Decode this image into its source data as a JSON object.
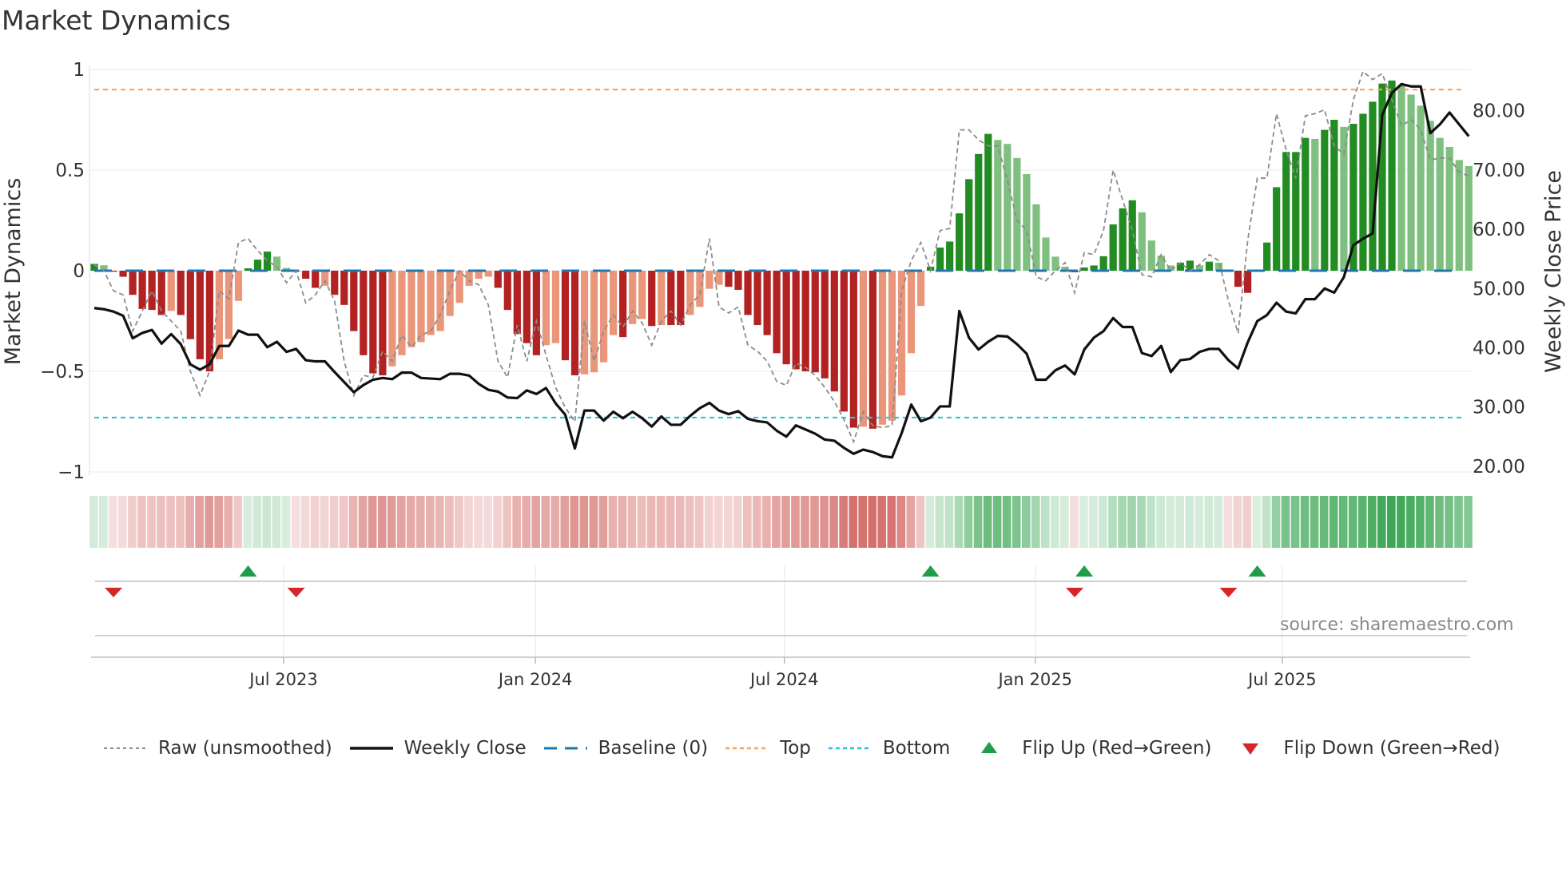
{
  "chart_data": {
    "type": "bar",
    "title": "Market Dynamics",
    "ylabel": "Market Dynamics",
    "y2label": "Weekly Close Price",
    "ylim": [
      -1.05,
      1.0
    ],
    "y2lim": [
      18.8,
      86.5
    ],
    "yticks": [
      {
        "v": 1,
        "label": "1"
      },
      {
        "v": 0.5,
        "label": "0.5"
      },
      {
        "v": 0,
        "label": "0"
      },
      {
        "v": -0.5,
        "label": "−0.5"
      },
      {
        "v": -1,
        "label": "−1"
      }
    ],
    "y2ticks": [
      {
        "v": 80,
        "label": "80.00"
      },
      {
        "v": 70,
        "label": "70.00"
      },
      {
        "v": 60,
        "label": "60.00"
      },
      {
        "v": 50,
        "label": "50.00"
      },
      {
        "v": 40,
        "label": "40.00"
      },
      {
        "v": 30,
        "label": "30.00"
      },
      {
        "v": 20,
        "label": "20.00"
      }
    ],
    "xticks": [
      {
        "week": 19.7,
        "label": "Jul 2023"
      },
      {
        "week": 45.9,
        "label": "Jan 2024"
      },
      {
        "week": 71.8,
        "label": "Jul 2024"
      },
      {
        "week": 97.9,
        "label": "Jan 2025"
      },
      {
        "week": 123.6,
        "label": "Jul 2025"
      }
    ],
    "top_level": 0.9,
    "bottom_level": -0.73,
    "baseline": 0,
    "values": [
      0.034,
      0.027,
      -0.005,
      -0.03,
      -0.12,
      -0.19,
      -0.195,
      -0.22,
      -0.2,
      -0.22,
      -0.34,
      -0.44,
      -0.5,
      -0.44,
      -0.34,
      -0.15,
      0.012,
      0.055,
      0.095,
      0.07,
      0.014,
      -0.003,
      -0.04,
      -0.085,
      -0.075,
      -0.12,
      -0.17,
      -0.3,
      -0.42,
      -0.51,
      -0.52,
      -0.475,
      -0.42,
      -0.38,
      -0.355,
      -0.32,
      -0.3,
      -0.225,
      -0.16,
      -0.075,
      -0.04,
      -0.03,
      -0.085,
      -0.195,
      -0.315,
      -0.36,
      -0.42,
      -0.37,
      -0.36,
      -0.445,
      -0.52,
      -0.515,
      -0.505,
      -0.455,
      -0.32,
      -0.33,
      -0.265,
      -0.24,
      -0.275,
      -0.27,
      -0.27,
      -0.27,
      -0.22,
      -0.18,
      -0.09,
      -0.07,
      -0.08,
      -0.095,
      -0.22,
      -0.27,
      -0.32,
      -0.41,
      -0.465,
      -0.49,
      -0.5,
      -0.505,
      -0.535,
      -0.6,
      -0.7,
      -0.78,
      -0.775,
      -0.785,
      -0.765,
      -0.745,
      -0.62,
      -0.41,
      -0.175,
      0.02,
      0.115,
      0.145,
      0.285,
      0.455,
      0.58,
      0.68,
      0.65,
      0.63,
      0.56,
      0.48,
      0.33,
      0.165,
      0.07,
      0.02,
      -0.008,
      0.016,
      0.026,
      0.072,
      0.23,
      0.31,
      0.35,
      0.29,
      0.15,
      0.075,
      0.026,
      0.04,
      0.05,
      0.027,
      0.045,
      0.04,
      -0.005,
      -0.08,
      -0.11,
      0.005,
      0.14,
      0.415,
      0.59,
      0.59,
      0.66,
      0.655,
      0.7,
      0.75,
      0.715,
      0.73,
      0.78,
      0.84,
      0.93,
      0.945,
      0.92,
      0.875,
      0.82,
      0.745,
      0.66,
      0.615,
      0.55,
      0.52
    ],
    "raw": [
      0.03,
      0.0,
      -0.1,
      -0.12,
      -0.3,
      -0.2,
      -0.1,
      -0.2,
      -0.25,
      -0.3,
      -0.5,
      -0.62,
      -0.5,
      -0.1,
      -0.14,
      0.14,
      0.16,
      0.1,
      0.05,
      0.02,
      -0.06,
      0.0,
      -0.16,
      -0.12,
      -0.05,
      -0.15,
      -0.45,
      -0.62,
      -0.52,
      -0.53,
      -0.4,
      -0.45,
      -0.32,
      -0.38,
      -0.32,
      -0.3,
      -0.22,
      -0.1,
      0.0,
      -0.05,
      -0.07,
      -0.17,
      -0.45,
      -0.53,
      -0.27,
      -0.45,
      -0.25,
      -0.42,
      -0.58,
      -0.68,
      -0.75,
      -0.25,
      -0.45,
      -0.3,
      -0.22,
      -0.28,
      -0.2,
      -0.26,
      -0.37,
      -0.25,
      -0.2,
      -0.27,
      -0.17,
      -0.12,
      0.16,
      -0.18,
      -0.21,
      -0.18,
      -0.37,
      -0.4,
      -0.45,
      -0.55,
      -0.57,
      -0.46,
      -0.48,
      -0.52,
      -0.58,
      -0.65,
      -0.74,
      -0.85,
      -0.7,
      -0.77,
      -0.78,
      -0.77,
      -0.1,
      0.05,
      0.14,
      0.0,
      0.2,
      0.21,
      0.7,
      0.7,
      0.65,
      0.62,
      0.62,
      0.45,
      0.25,
      0.2,
      -0.03,
      -0.05,
      0.0,
      0.04,
      -0.11,
      0.09,
      0.08,
      0.2,
      0.5,
      0.35,
      0.2,
      -0.02,
      -0.03,
      0.08,
      0.0,
      0.04,
      0.0,
      0.03,
      0.08,
      0.05,
      -0.15,
      -0.31,
      0.15,
      0.46,
      0.46,
      0.78,
      0.6,
      0.46,
      0.77,
      0.78,
      0.8,
      0.62,
      0.58,
      0.85,
      0.99,
      0.95,
      0.98,
      0.85,
      0.72,
      0.75,
      0.7,
      0.55,
      0.56,
      0.56,
      0.49,
      0.47
    ],
    "weekly_close": [
      46.7,
      46.5,
      46.1,
      45.4,
      41.6,
      42.5,
      43.0,
      40.7,
      42.3,
      40.6,
      37.2,
      36.3,
      37.2,
      40.3,
      40.3,
      42.9,
      42.2,
      42.2,
      40.1,
      41.0,
      39.3,
      39.8,
      37.9,
      37.7,
      37.7,
      35.9,
      34.2,
      32.5,
      33.7,
      34.6,
      34.9,
      34.7,
      35.8,
      35.8,
      34.9,
      34.8,
      34.7,
      35.6,
      35.6,
      35.3,
      33.9,
      32.9,
      32.6,
      31.6,
      31.5,
      32.8,
      32.2,
      33.2,
      30.6,
      28.7,
      23.0,
      29.4,
      29.4,
      27.7,
      29.2,
      28.1,
      29.2,
      28.1,
      26.7,
      28.4,
      27.0,
      27.0,
      28.5,
      29.8,
      30.7,
      29.4,
      28.8,
      29.3,
      28.0,
      27.6,
      27.4,
      26.0,
      25.0,
      26.9,
      26.2,
      25.5,
      24.5,
      24.3,
      23.1,
      22.1,
      22.8,
      22.4,
      21.7,
      21.5,
      25.6,
      30.4,
      27.6,
      28.2,
      30.1,
      30.1,
      46.2,
      41.7,
      39.7,
      41.0,
      42.0,
      41.9,
      40.6,
      39.0,
      34.6,
      34.6,
      36.2,
      37.0,
      35.5,
      39.7,
      41.7,
      42.8,
      45.0,
      43.5,
      43.5,
      39.1,
      38.6,
      40.3,
      35.9,
      37.9,
      38.1,
      39.3,
      39.8,
      39.8,
      37.9,
      36.5,
      40.9,
      44.5,
      45.5,
      47.6,
      46.1,
      45.8,
      48.2,
      48.2,
      50.0,
      49.3,
      51.9,
      57.3,
      58.4,
      59.3,
      79.3,
      83.0,
      84.5,
      84.1,
      84.1,
      76.2,
      77.7,
      79.7,
      77.7,
      75.7
    ],
    "flip_up_weeks": [
      16,
      87,
      103,
      121
    ],
    "flip_down_weeks": [
      2,
      21,
      102,
      118
    ],
    "legend": {
      "raw": "Raw (unsmoothed)",
      "close": "Weekly Close",
      "baseline": "Baseline (0)",
      "top": "Top",
      "bottom": "Bottom",
      "flip_up": "Flip Up (Red→Green)",
      "flip_down": "Flip Down (Green→Red)"
    },
    "legend_placement": "bottom",
    "source": "source: sharemaestro.com"
  },
  "colors": {
    "green_strong": "#228b22",
    "green_weak": "#7fbf7f",
    "red_strong": "#b22222",
    "red_weak": "#e9967a",
    "close": "#111111",
    "raw": "#8c8c8c",
    "baseline": "#1f77b4",
    "top": "#f4a460",
    "bottom": "#2ec4d6",
    "flip_up": "#1e9e4a",
    "flip_down": "#d62728"
  }
}
